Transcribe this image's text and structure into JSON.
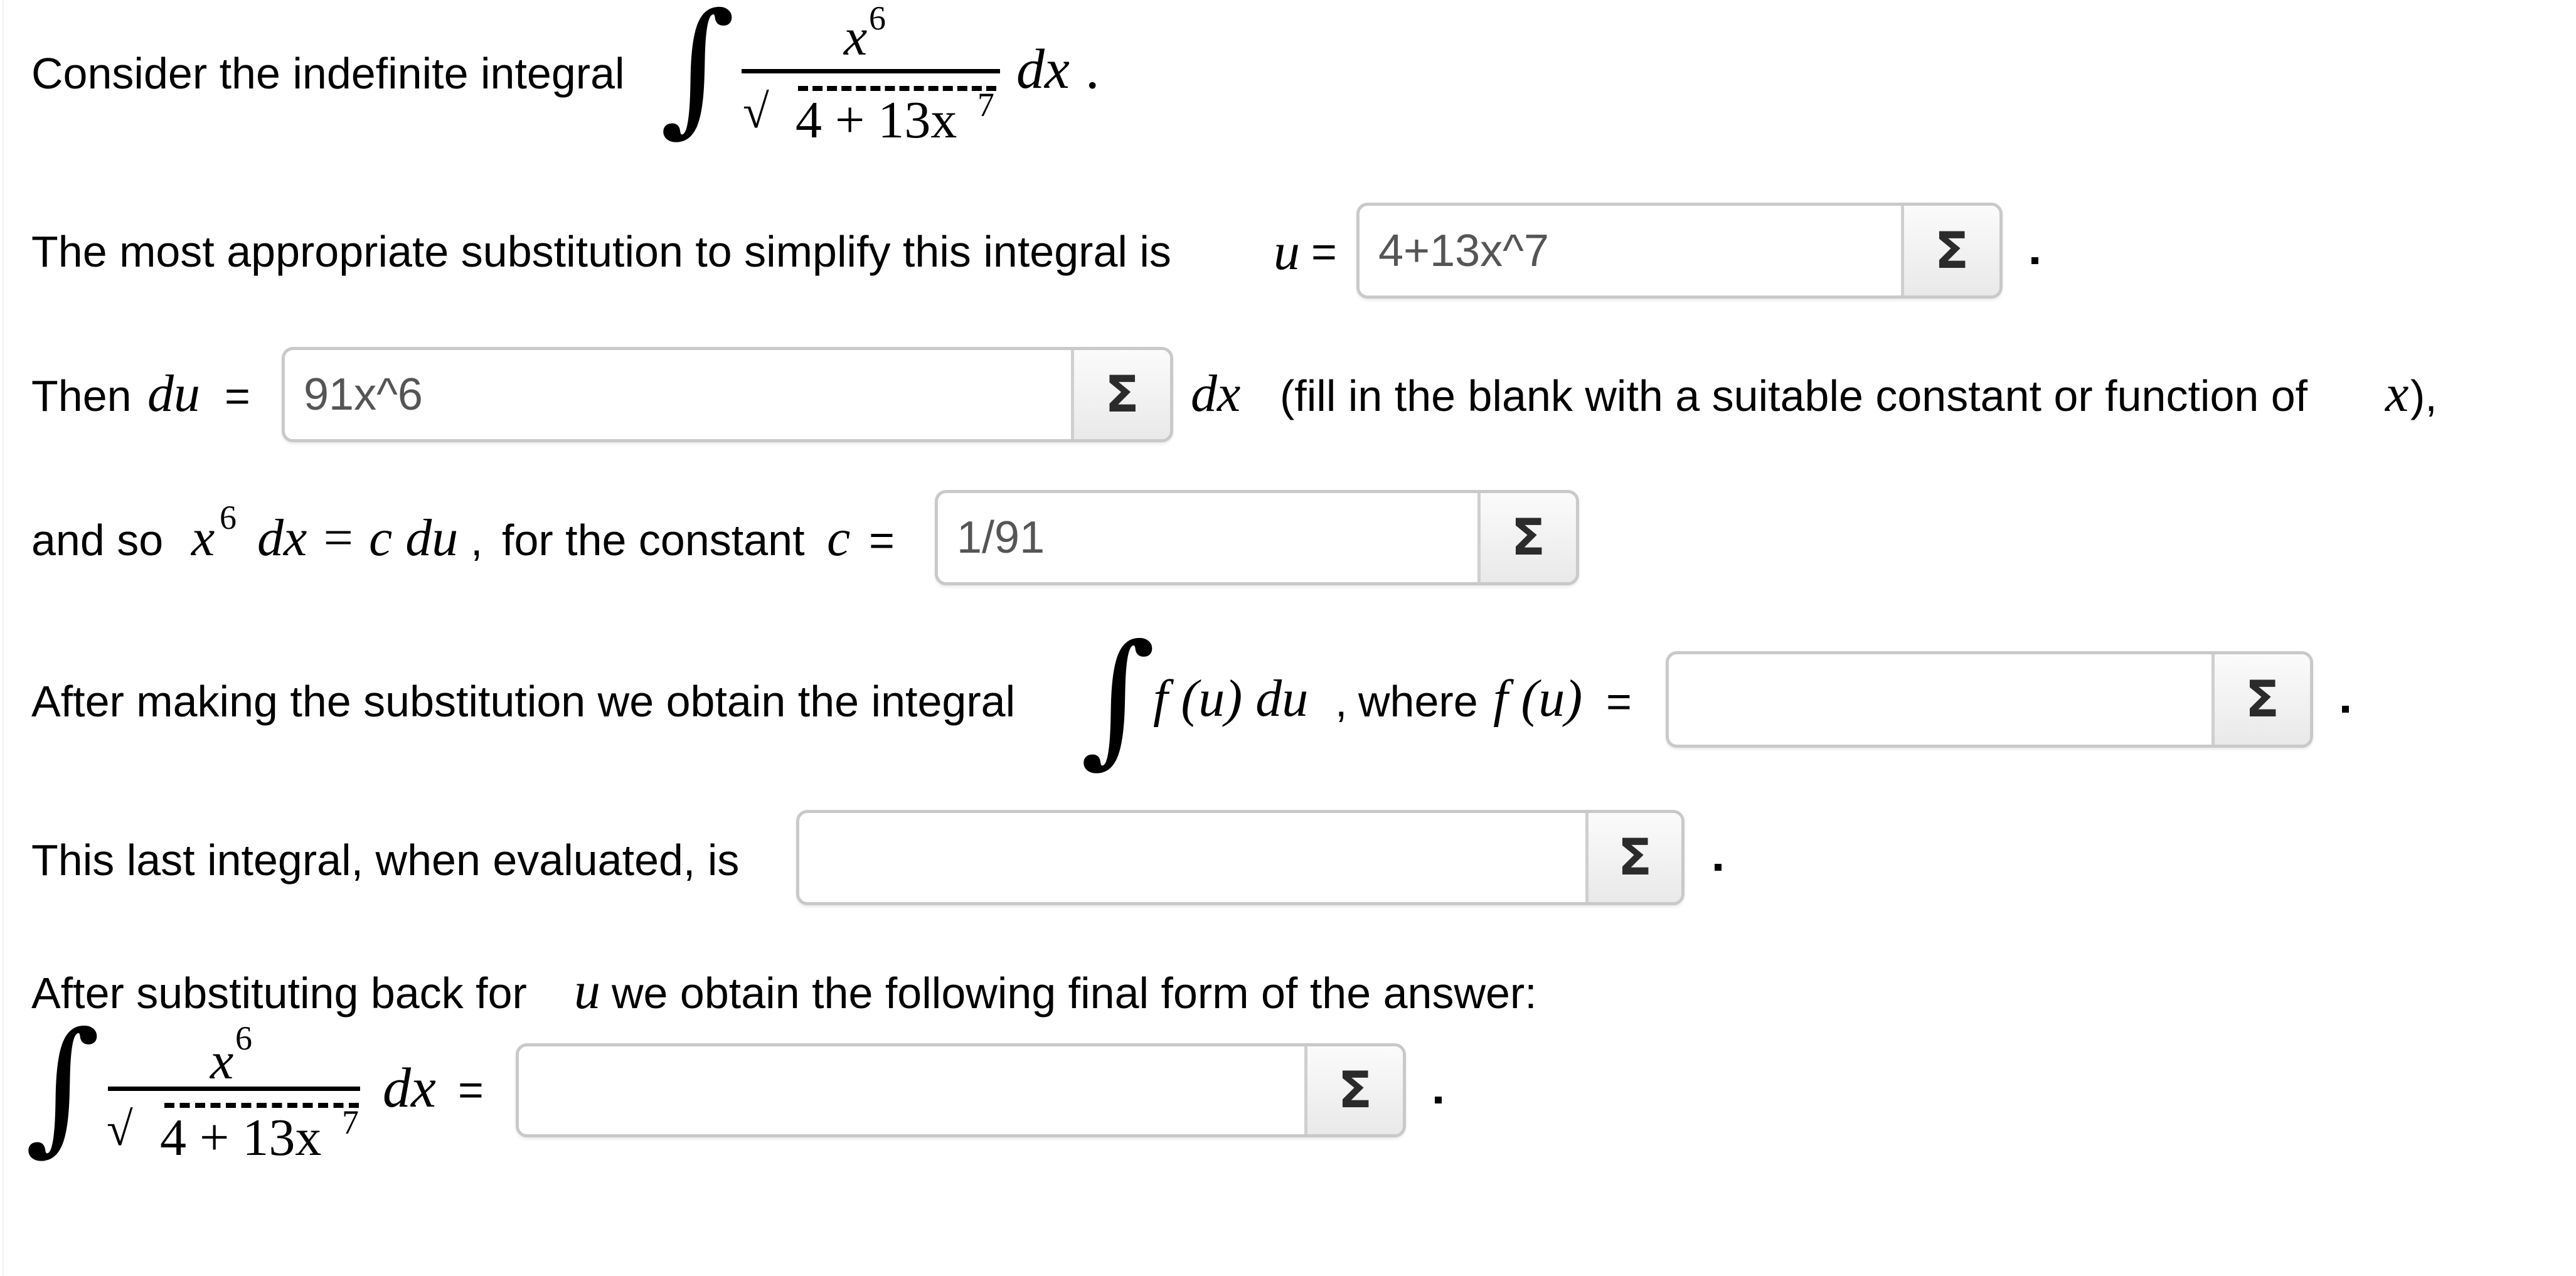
{
  "question": {
    "intro_text": "Consider the indefinite integral",
    "integrand": {
      "numerator_base": "x",
      "numerator_exp": "6",
      "sqrt_symbol": "√",
      "denominator": "4 + 13x",
      "denominator_exp": "7",
      "differential": "dx",
      "end_punct": "."
    },
    "integral_sign": "∫"
  },
  "rows": {
    "u": {
      "label": "The most appropriate substitution to simplify this integral is",
      "var": "u",
      "equals": "=",
      "value": "4+13x^7",
      "suffix": "."
    },
    "du": {
      "prefix": "Then",
      "var": "du",
      "equals": "=",
      "value": "91x^6",
      "after_var": "dx",
      "after_text": "(fill in the blank with a suitable constant or function of",
      "after_var2": "x",
      "after_end": "),"
    },
    "c": {
      "prefix": "and so",
      "expr_base": "x",
      "expr_exp": "6",
      "expr_rest": "dx = c du",
      "comma": ",",
      "label": "for the constant",
      "var": "c",
      "equals": "=",
      "value": "1/91"
    },
    "fu": {
      "label": "After making the substitution we obtain the integral",
      "integral_sign": "∫",
      "expr": "f (u) du",
      "comma": ",",
      "where": "where",
      "var": "f (u)",
      "equals": "=",
      "value": "",
      "suffix": "."
    },
    "evaluated": {
      "label": "This last integral, when evaluated, is",
      "value": "",
      "suffix": "."
    },
    "final": {
      "label_pre": "After substituting back for",
      "label_var": "u",
      "label_post": "we obtain the following final form of the answer:",
      "integral_sign": "∫",
      "numerator_base": "x",
      "numerator_exp": "6",
      "sqrt_symbol": "√",
      "denominator": "4 + 13x",
      "denominator_exp": "7",
      "differential": "dx",
      "equals": "=",
      "value": "",
      "suffix": "."
    }
  },
  "sigma_button": {
    "label": "Σ"
  },
  "colors": {
    "field_border": "#c9c9c9",
    "input_text": "#555555",
    "sigma": "#2b2b2b"
  }
}
